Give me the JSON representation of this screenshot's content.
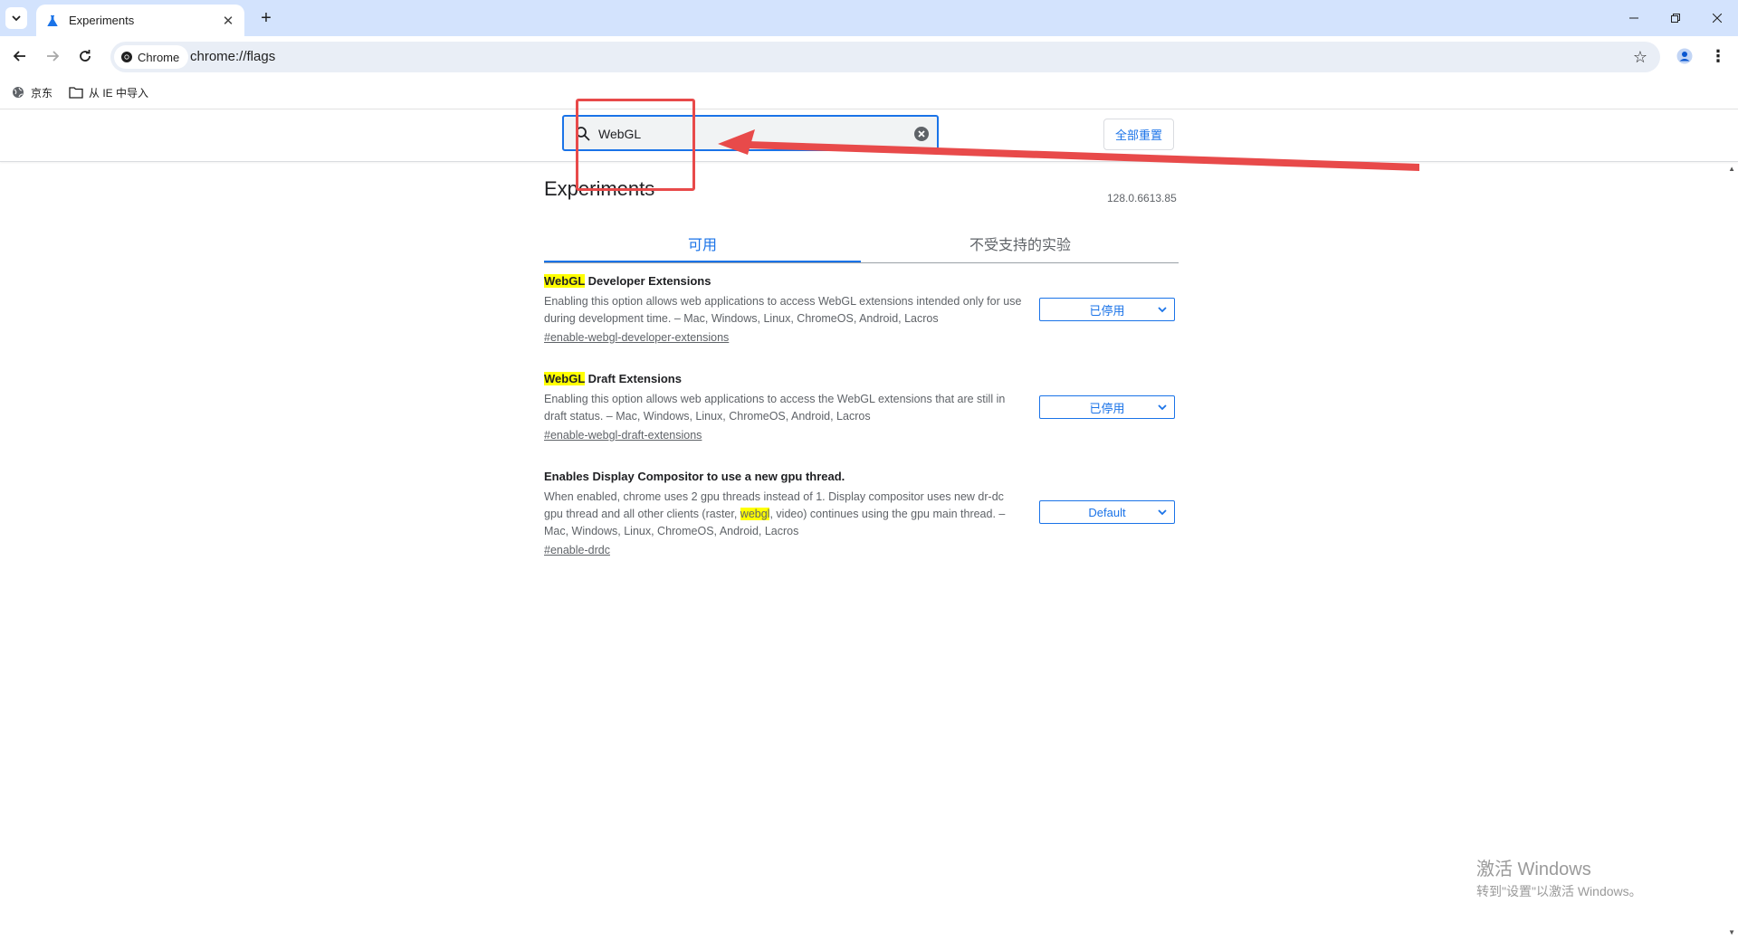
{
  "browser": {
    "tab_title": "Experiments",
    "new_tab_symbol": "+",
    "chip_label": "Chrome",
    "url": "chrome://flags"
  },
  "bookmarks": [
    {
      "label": "京东",
      "icon": "globe-icon"
    },
    {
      "label": "从 IE 中导入",
      "icon": "folder-icon"
    }
  ],
  "search": {
    "value": "WebGL",
    "reset_label": "全部重置"
  },
  "page": {
    "title": "Experiments",
    "version": "128.0.6613.85",
    "tabs": [
      {
        "label": "可用",
        "active": true
      },
      {
        "label": "不受支持的实验",
        "active": false
      }
    ]
  },
  "experiments": [
    {
      "title_highlight": "WebGL",
      "title_rest": " Developer Extensions",
      "description": "Enabling this option allows web applications to access WebGL extensions intended only for use during development time. – Mac, Windows, Linux, ChromeOS, Android, Lacros",
      "link": "#enable-webgl-developer-extensions",
      "selected": "已停用"
    },
    {
      "title_highlight": "WebGL",
      "title_rest": " Draft Extensions",
      "description": "Enabling this option allows web applications to access the WebGL extensions that are still in draft status. – Mac, Windows, Linux, ChromeOS, Android, Lacros",
      "link": "#enable-webgl-draft-extensions",
      "selected": "已停用"
    },
    {
      "title": "Enables Display Compositor to use a new gpu thread.",
      "description_before": "When enabled, chrome uses 2 gpu threads instead of 1. Display compositor uses new dr-dc gpu thread and all other clients (raster, ",
      "description_highlight": "webgl",
      "description_after": ", video) continues using the gpu main thread. – Mac, Windows, Linux, ChromeOS, Android, Lacros",
      "link": "#enable-drdc",
      "selected": "Default"
    }
  ],
  "watermark": {
    "line1": "激活 Windows",
    "line2": "转到\"设置\"以激活 Windows。"
  },
  "colors": {
    "accent": "#1a73e8",
    "annotation": "#e84a4a",
    "highlight": "#ffff00",
    "tabstrip": "#d3e3fd"
  }
}
